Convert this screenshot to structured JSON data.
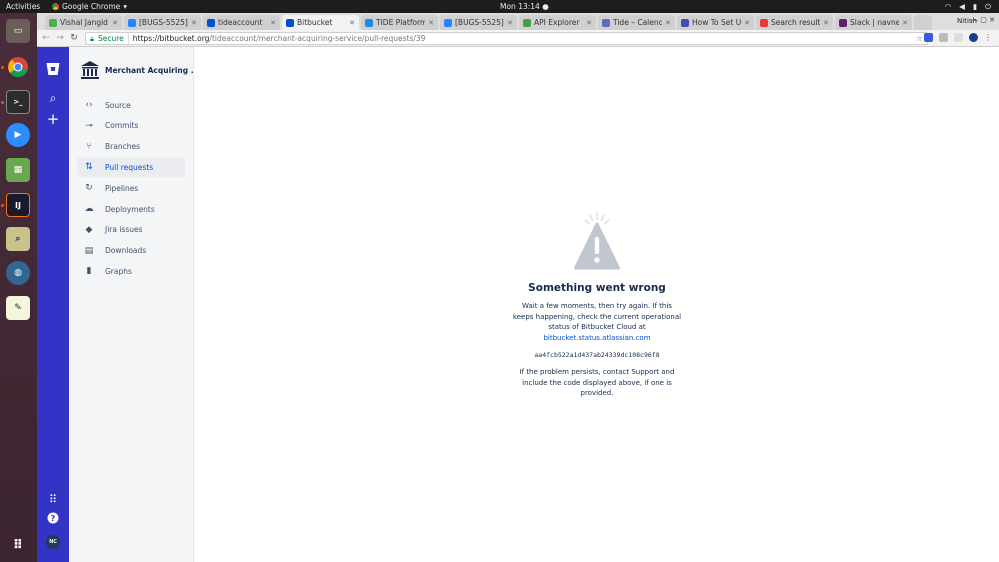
{
  "topbar": {
    "activities": "Activities",
    "app_name": "Google Chrome",
    "clock": "Mon 13:14",
    "user": "Nitish"
  },
  "browser": {
    "tabs": [
      {
        "title": "Vishal Jangid",
        "favicon_color": "#4caf50",
        "active": false
      },
      {
        "title": "[BUGS-5525]",
        "favicon_color": "#2684ff",
        "active": false
      },
      {
        "title": "tideaccount",
        "favicon_color": "#0052cc",
        "active": false
      },
      {
        "title": "Bitbucket",
        "favicon_color": "#0052cc",
        "active": true
      },
      {
        "title": "TIDE Platform",
        "favicon_color": "#1e88e5",
        "active": false
      },
      {
        "title": "[BUGS-5525]",
        "favicon_color": "#2684ff",
        "active": false
      },
      {
        "title": "API Explorer",
        "favicon_color": "#43a047",
        "active": false
      },
      {
        "title": "Tide – Calend",
        "favicon_color": "#5c6bc0",
        "active": false
      },
      {
        "title": "How To Set U",
        "favicon_color": "#3f51b5",
        "active": false
      },
      {
        "title": "Search result",
        "favicon_color": "#e53935",
        "active": false
      },
      {
        "title": "Slack | navne",
        "favicon_color": "#611f69",
        "active": false
      }
    ],
    "secure_label": "Secure",
    "url_host": "https://bitbucket.org",
    "url_path": "/tideaccount/merchant-acquiring-service/pull-requests/39"
  },
  "sidebar": {
    "repo_name": "Merchant Acquiring ...",
    "items": [
      {
        "label": "Source",
        "icon": "code-icon",
        "glyph": "‹›",
        "selected": false
      },
      {
        "label": "Commits",
        "icon": "commit-icon",
        "glyph": "⊸",
        "selected": false
      },
      {
        "label": "Branches",
        "icon": "branch-icon",
        "glyph": "⑂",
        "selected": false
      },
      {
        "label": "Pull requests",
        "icon": "pull-request-icon",
        "glyph": "⇅",
        "selected": true
      },
      {
        "label": "Pipelines",
        "icon": "pipelines-icon",
        "glyph": "↻",
        "selected": false
      },
      {
        "label": "Deployments",
        "icon": "deployments-icon",
        "glyph": "☁",
        "selected": false
      },
      {
        "label": "Jira issues",
        "icon": "jira-icon",
        "glyph": "◆",
        "selected": false
      },
      {
        "label": "Downloads",
        "icon": "downloads-icon",
        "glyph": "▤",
        "selected": false
      },
      {
        "label": "Graphs",
        "icon": "graphs-icon",
        "glyph": "▮",
        "selected": false
      }
    ]
  },
  "globalnav": {
    "avatar_initials": "NC"
  },
  "error": {
    "title": "Something went wrong",
    "body": "Wait a few moments, then try again. If this keeps happening, check the current operational status of Bitbucket Cloud at",
    "status_link": "bitbucket.status.atlassian.com",
    "code": "aa4fcb522a1d437ab24339dc108c96f8",
    "footer": "If the problem persists, contact Support and include the code displayed above, if one is provided."
  },
  "colors": {
    "global_nav": "#3333c6",
    "link": "#0052cc",
    "dock": "#4a2d3a"
  }
}
